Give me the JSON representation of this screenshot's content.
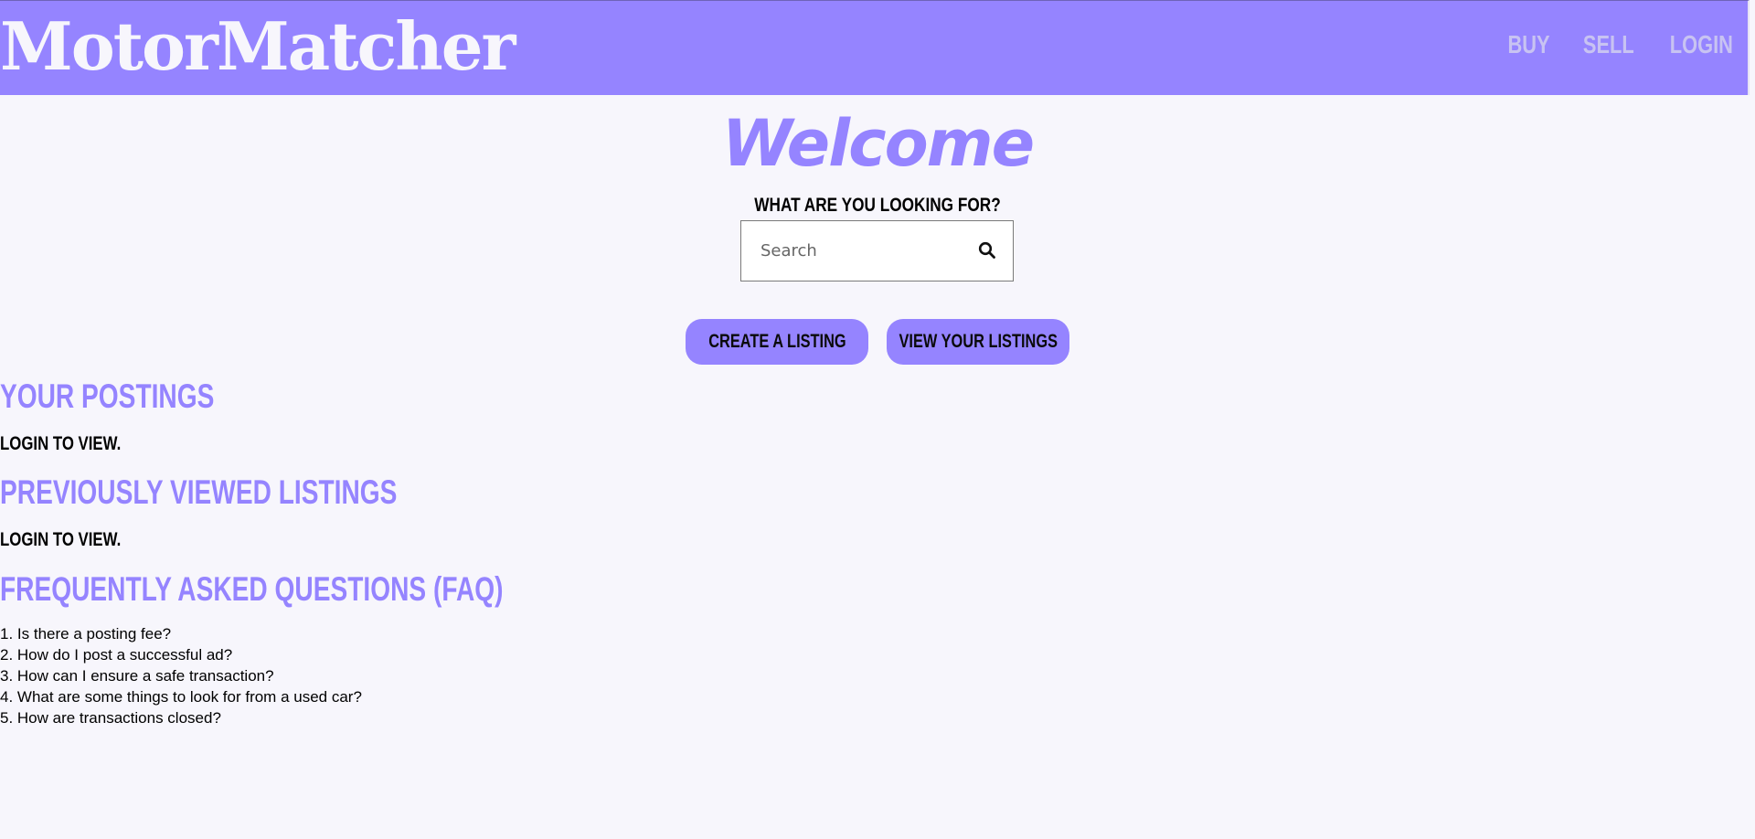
{
  "header": {
    "brand": "MotorMatcher",
    "nav": [
      {
        "label": "BUY"
      },
      {
        "label": "SELL"
      },
      {
        "label": "LOGIN"
      }
    ]
  },
  "hero": {
    "title": "Welcome",
    "prompt": "WHAT ARE YOU LOOKING FOR?",
    "search": {
      "placeholder": "Search",
      "value": "",
      "icon": "search-icon"
    }
  },
  "actions": {
    "create_label": "CREATE A LISTING",
    "view_label": "VIEW YOUR LISTINGS"
  },
  "sections": {
    "postings": {
      "title": "YOUR POSTINGS",
      "message": "LOGIN TO VIEW."
    },
    "viewed": {
      "title": "PREVIOUSLY VIEWED LISTINGS",
      "message": "LOGIN TO VIEW."
    },
    "faq": {
      "title": "FREQUENTLY ASKED QUESTIONS (FAQ)",
      "items": [
        "1. Is there a posting fee?",
        "2. How do I post a successful ad?",
        "3. How can I ensure a safe transaction?",
        "4. What are some things to look for from a used car?",
        "5. How are transactions closed?"
      ]
    }
  },
  "colors": {
    "accent": "#9584ff",
    "background": "#f7f6fc",
    "nav_text": "#c8c3f2"
  }
}
